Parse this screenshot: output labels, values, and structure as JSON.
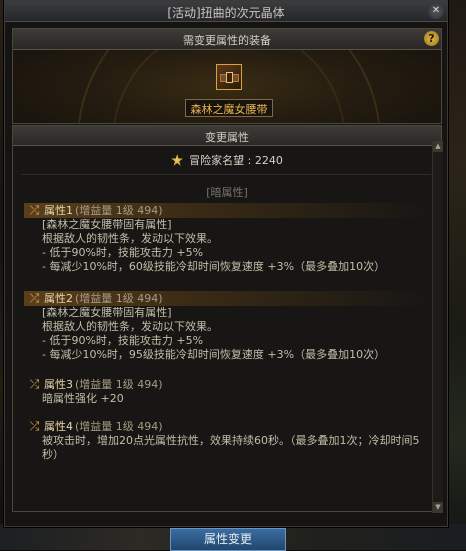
{
  "window": {
    "title": "[活动]扭曲的次元晶体",
    "close_icon": "close-icon"
  },
  "equipment": {
    "header": "需变更属性的装备",
    "help_label": "?",
    "item_name": "森林之魔女腰带",
    "item_icon": "belt-icon"
  },
  "change": {
    "header": "变更属性",
    "fame_icon": "fame-star-icon",
    "fame_text": "冒险家名望 : 2240",
    "element_label": "[暗属性]"
  },
  "attributes": [
    {
      "title": "属性1",
      "sub": "(增益量 1级 494)",
      "lines": [
        "[森林之魔女腰带固有属性]",
        "根据敌人的韧性条，发动以下效果。",
        "- 低于90%时，技能攻击力 +5%",
        "- 每减少10%时，60级技能冷却时间恢复速度 +3%（最多叠加10次）"
      ]
    },
    {
      "title": "属性2",
      "sub": "(增益量 1级 494)",
      "lines": [
        "[森林之魔女腰带固有属性]",
        "根据敌人的韧性条，发动以下效果。",
        "- 低于90%时，技能攻击力 +5%",
        "- 每减少10%时，95级技能冷却时间恢复速度 +3%（最多叠加10次）"
      ]
    },
    {
      "title": "属性3",
      "sub": "(增益量 1级 494)",
      "lines": [
        "暗属性强化 +20"
      ]
    },
    {
      "title": "属性4",
      "sub": "(增益量 1级 494)",
      "lines": [
        "被攻击时，增加20点光属性抗性，效果持续60秒。（最多叠加1次；冷却时间5秒）"
      ]
    }
  ],
  "scrollbar": {
    "up_label": "▲",
    "down_label": "▼"
  },
  "footer": {
    "button_label": "属性变更"
  },
  "colors": {
    "accent_gold": "#e8b450",
    "button_blue": "#2f5d8c"
  }
}
